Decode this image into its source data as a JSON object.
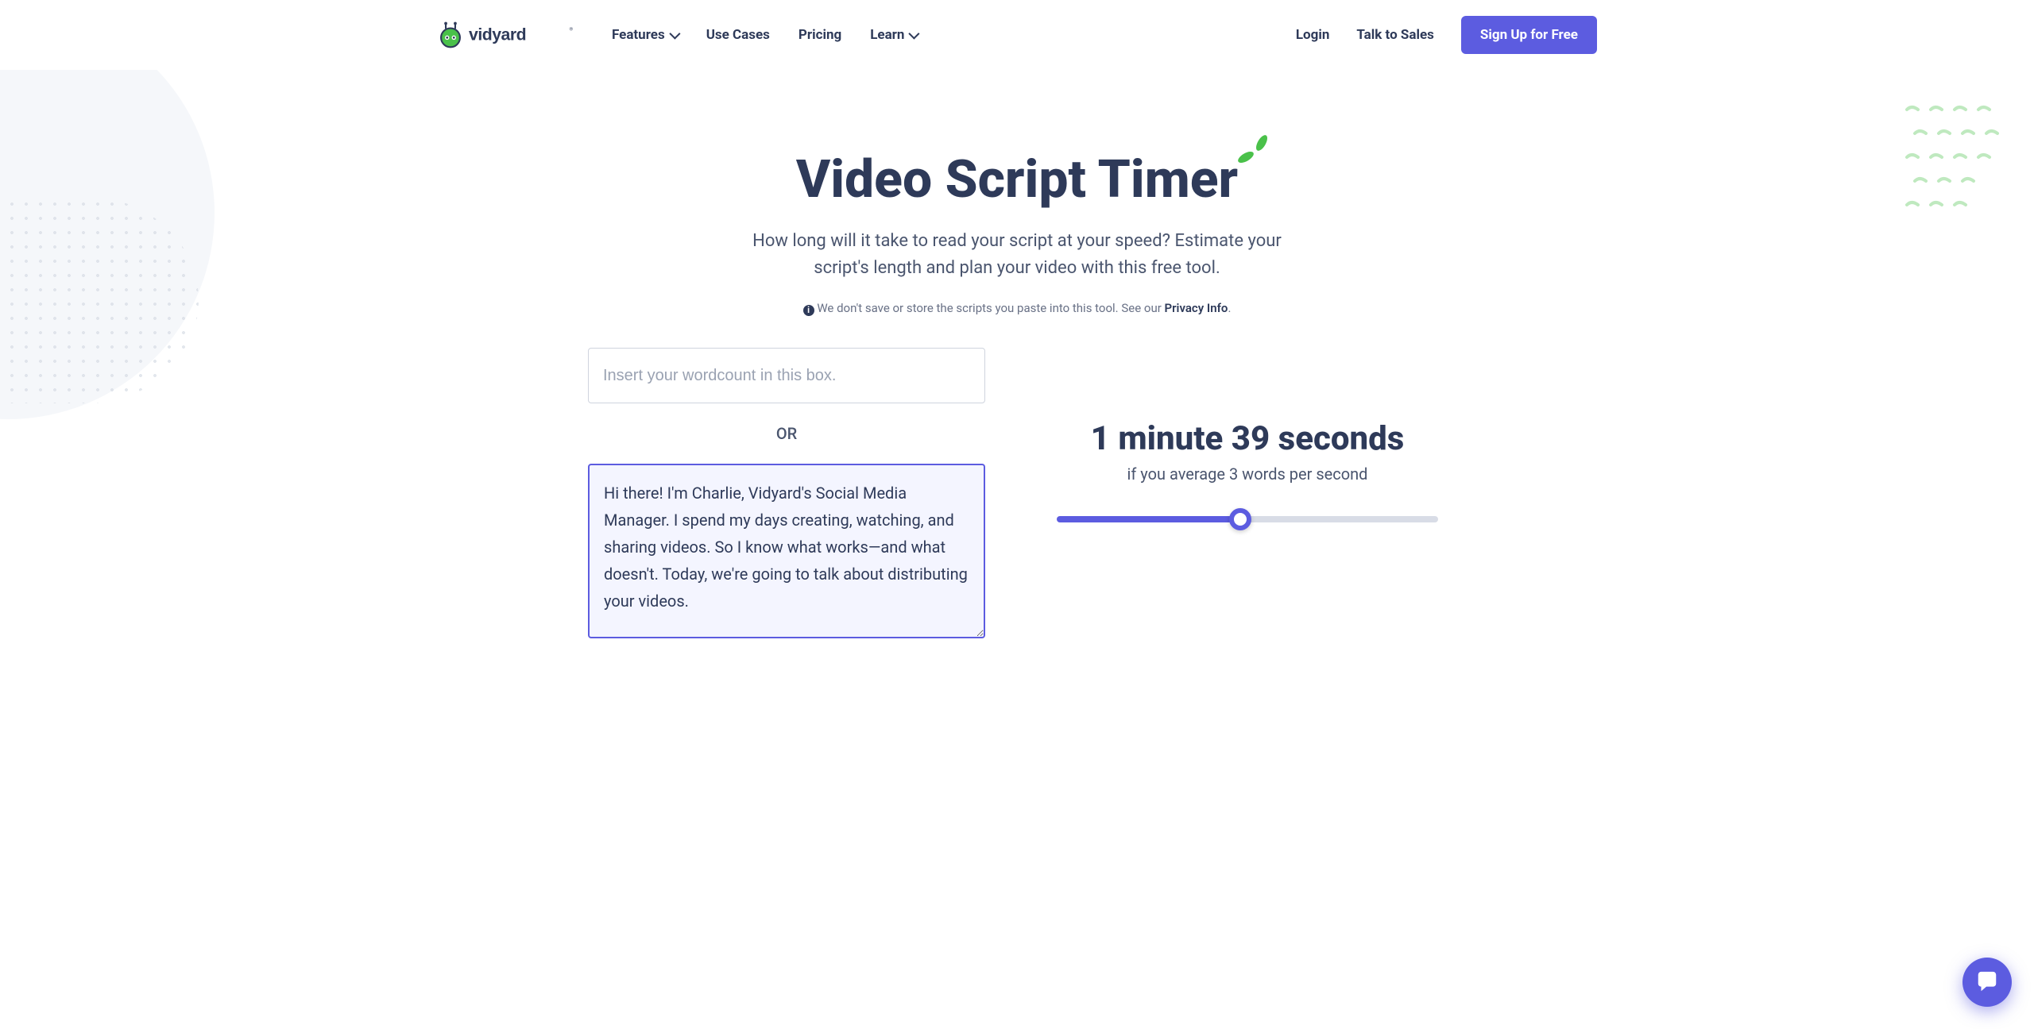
{
  "nav": {
    "brand": "vidyard",
    "links": {
      "features": "Features",
      "use_cases": "Use Cases",
      "pricing": "Pricing",
      "learn": "Learn"
    },
    "right": {
      "login": "Login",
      "talk_to_sales": "Talk to Sales",
      "signup": "Sign Up for Free"
    }
  },
  "hero": {
    "title": "Video Script Timer",
    "subtitle": "How long will it take to read your script at your speed? Estimate your script's length and plan your video with this free tool.",
    "privacy_prefix": "We don't save or store the scripts you paste into this tool. See our ",
    "privacy_link": "Privacy Info",
    "privacy_suffix": "."
  },
  "tool": {
    "wordcount_placeholder": "Insert your wordcount in this box.",
    "or_label": "OR",
    "script_value": "Hi there! I'm Charlie, Vidyard's Social Media Manager. I spend my days creating, watching, and sharing videos. So I know what works—and what doesn't. Today, we're going to talk about distributing your videos.",
    "result_time": "1 minute 39 seconds",
    "result_rate": "if you average 3 words per second",
    "slider_value": 48
  }
}
